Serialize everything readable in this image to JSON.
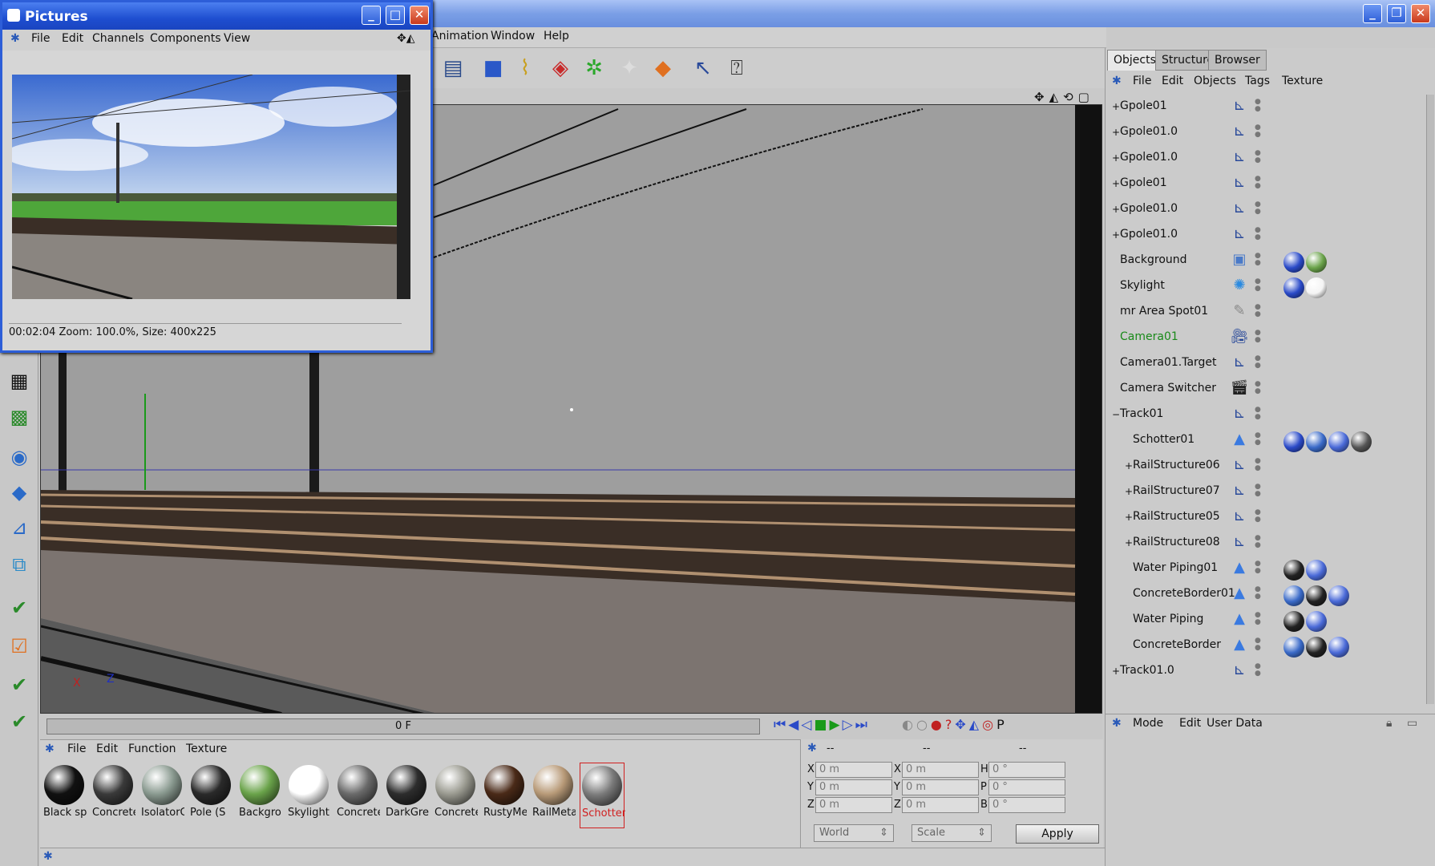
{
  "main_menu": [
    "Animation",
    "Window",
    "Help"
  ],
  "picture_viewer": {
    "title": "Pictures",
    "menu": [
      "File",
      "Edit",
      "Channels",
      "Components",
      "View"
    ],
    "status": "00:02:04  Zoom: 100.0%, Size: 400x225"
  },
  "timeline": {
    "frame": "0 F"
  },
  "material_manager": {
    "menu": [
      "File",
      "Edit",
      "Function",
      "Texture"
    ],
    "materials": [
      {
        "label": "Black sp",
        "color": "#111111"
      },
      {
        "label": "Concrete",
        "color": "#3a3a3a"
      },
      {
        "label": "IsolatorG",
        "color": "#8a9a90"
      },
      {
        "label": "Pole (S",
        "color": "#2a2a2a"
      },
      {
        "label": "Backgro",
        "color": "#6aa34a"
      },
      {
        "label": "Skylight",
        "color": "#ffffff"
      },
      {
        "label": "Concrete",
        "color": "#6a6a6a"
      },
      {
        "label": "DarkGre",
        "color": "#2d2d2d"
      },
      {
        "label": "Concrete",
        "color": "#9a9a90"
      },
      {
        "label": "RustyMe",
        "color": "#4a2a18"
      },
      {
        "label": "RailMeta",
        "color": "#b89a78"
      },
      {
        "label": "Schotter",
        "color": "#7a7a7a",
        "selected": true
      }
    ]
  },
  "coordinates": {
    "header": [
      "--",
      "--",
      "--"
    ],
    "rows": [
      {
        "a_label": "X",
        "a": "0 m",
        "b_label": "X",
        "b": "0 m",
        "c_label": "H",
        "c": "0 °"
      },
      {
        "a_label": "Y",
        "a": "0 m",
        "b_label": "Y",
        "b": "0 m",
        "c_label": "P",
        "c": "0 °"
      },
      {
        "a_label": "Z",
        "a": "0 m",
        "b_label": "Z",
        "b": "0 m",
        "c_label": "B",
        "c": "0 °"
      }
    ],
    "space_select": "World",
    "mode_select": "Scale",
    "apply": "Apply"
  },
  "object_manager": {
    "tabs": [
      "Objects",
      "Structure",
      "Browser"
    ],
    "menu": [
      "File",
      "Edit",
      "Objects",
      "Tags",
      "Texture"
    ],
    "objects": [
      {
        "name": "Gpole01",
        "indent": 0,
        "exp": "+",
        "icon": "null-icon",
        "tags": []
      },
      {
        "name": "Gpole01.0",
        "indent": 0,
        "exp": "+",
        "icon": "null-icon",
        "tags": []
      },
      {
        "name": "Gpole01.0",
        "indent": 0,
        "exp": "+",
        "icon": "null-icon",
        "tags": []
      },
      {
        "name": "Gpole01",
        "indent": 0,
        "exp": "+",
        "icon": "null-icon",
        "tags": []
      },
      {
        "name": "Gpole01.0",
        "indent": 0,
        "exp": "+",
        "icon": "null-icon",
        "tags": []
      },
      {
        "name": "Gpole01.0",
        "indent": 0,
        "exp": "+",
        "icon": "null-icon",
        "tags": []
      },
      {
        "name": "Background",
        "indent": 0,
        "exp": "",
        "icon": "background-icon",
        "tags": [
          "compositing",
          "material-green"
        ]
      },
      {
        "name": "Skylight",
        "indent": 0,
        "exp": "",
        "icon": "sky-icon",
        "tags": [
          "compositing",
          "material-white"
        ]
      },
      {
        "name": "mr Area Spot01",
        "indent": 0,
        "exp": "",
        "icon": "light-icon",
        "tags": []
      },
      {
        "name": "Camera01",
        "indent": 0,
        "exp": "",
        "icon": "camera-icon",
        "tags": [],
        "highlight": true
      },
      {
        "name": "Camera01.Target",
        "indent": 0,
        "exp": "",
        "icon": "null-icon",
        "tags": []
      },
      {
        "name": "Camera Switcher",
        "indent": 0,
        "exp": "",
        "icon": "clapper-icon",
        "tags": []
      },
      {
        "name": "Track01",
        "indent": 0,
        "exp": "−",
        "icon": "null-icon",
        "tags": []
      },
      {
        "name": "Schotter01",
        "indent": 1,
        "exp": "",
        "icon": "polygon-icon",
        "tags": [
          "compositing",
          "uvw",
          "phong",
          "material-gravel"
        ]
      },
      {
        "name": "RailStructure06",
        "indent": 1,
        "exp": "+",
        "icon": "null-icon",
        "tags": []
      },
      {
        "name": "RailStructure07",
        "indent": 1,
        "exp": "+",
        "icon": "null-icon",
        "tags": []
      },
      {
        "name": "RailStructure05",
        "indent": 1,
        "exp": "+",
        "icon": "null-icon",
        "tags": []
      },
      {
        "name": "RailStructure08",
        "indent": 1,
        "exp": "+",
        "icon": "null-icon",
        "tags": []
      },
      {
        "name": "Water Piping01",
        "indent": 1,
        "exp": "",
        "icon": "polygon-icon",
        "tags": [
          "material-dark",
          "phong"
        ]
      },
      {
        "name": "ConcreteBorder01",
        "indent": 1,
        "exp": "",
        "icon": "polygon-icon",
        "tags": [
          "uvw",
          "material-dark",
          "phong"
        ]
      },
      {
        "name": "Water Piping",
        "indent": 1,
        "exp": "",
        "icon": "polygon-icon",
        "tags": [
          "material-dark",
          "phong"
        ]
      },
      {
        "name": "ConcreteBorder",
        "indent": 1,
        "exp": "",
        "icon": "polygon-icon",
        "tags": [
          "uvw",
          "material-dark",
          "phong"
        ]
      },
      {
        "name": "Track01.0",
        "indent": 0,
        "exp": "+",
        "icon": "null-icon",
        "tags": []
      }
    ]
  },
  "attribute_manager": {
    "menu": [
      "Mode",
      "Edit",
      "User Data"
    ]
  },
  "colors": {
    "highlight_text": "#1a8a1a",
    "accent_blue": "#2d5ed8",
    "selected_mat_label": "#d02020"
  }
}
